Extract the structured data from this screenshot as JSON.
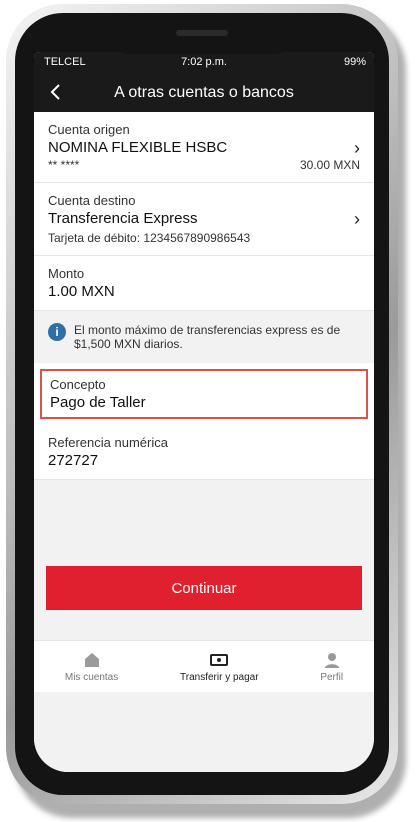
{
  "status": {
    "carrier": "TELCEL",
    "time": "7:02 p.m.",
    "battery": "99%"
  },
  "header": {
    "title": "A otras cuentas o bancos"
  },
  "cuenta_origen": {
    "label": "Cuenta origen",
    "name": "NOMINA FLEXIBLE HSBC",
    "masked": "** ****",
    "amount": "30.00 MXN"
  },
  "cuenta_destino": {
    "label": "Cuenta destino",
    "name": "Transferencia Express",
    "card": "Tarjeta de débito: 1234567890986543"
  },
  "monto": {
    "label": "Monto",
    "value": "1.00 MXN"
  },
  "info": {
    "text": "El monto máximo de transferencias express es de $1,500 MXN diarios."
  },
  "concepto": {
    "label": "Concepto",
    "value": "Pago de Taller"
  },
  "referencia": {
    "label": "Referencia numérica",
    "value": "272727"
  },
  "cta": {
    "label": "Continuar"
  },
  "tabs": [
    {
      "label": "Mis cuentas",
      "icon": "home-icon"
    },
    {
      "label": "Transferir y pagar",
      "icon": "transfer-icon"
    },
    {
      "label": "Perfil",
      "icon": "user-icon"
    }
  ],
  "colors": {
    "primary": "#e01f2f",
    "header": "#1a1a1a",
    "highlight_border": "#d8534d"
  }
}
